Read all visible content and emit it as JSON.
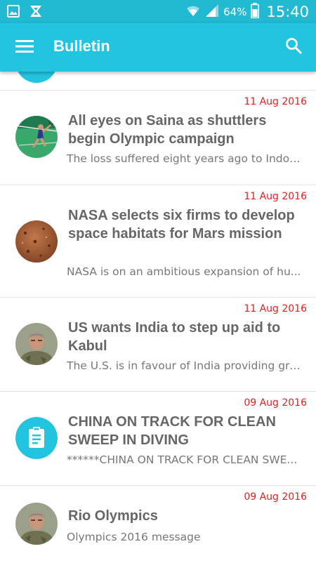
{
  "status_bar": {
    "battery_percent": "64%",
    "time": "15:40",
    "icons": [
      "gallery-notification-icon",
      "x-notification-icon",
      "wifi-icon",
      "signal-icon",
      "battery-icon"
    ]
  },
  "app_bar": {
    "title": "Bulletin",
    "menu_icon": "hamburger-menu-icon",
    "search_icon": "search-icon"
  },
  "colors": {
    "status_bar": "#22b9d2",
    "app_bar": "#22c4df",
    "date": "#e02020",
    "title": "#666666",
    "desc": "#777777",
    "divider": "#e2e2e2"
  },
  "items": [
    {
      "date": "11 Aug 2016",
      "title": "All eyes on Saina as shuttlers begin Olympic campaign",
      "desc": "The loss suffered eight years ago to Indon...",
      "avatar": "badminton-photo"
    },
    {
      "date": "11 Aug 2016",
      "title": "NASA selects six firms to develop space habitats for Mars mission",
      "desc": "NASA is on an ambitious expansion of hu...",
      "avatar": "mars-surface-photo"
    },
    {
      "date": "11 Aug 2016",
      "title": "US wants India to step up aid to Kabul",
      "desc": "The U.S. is in favour of India providing gre...",
      "avatar": "soldier-photo"
    },
    {
      "date": "09 Aug 2016",
      "title": "CHINA ON TRACK FOR CLEAN SWEEP IN DIVING",
      "desc": "******CHINA ON TRACK FOR CLEAN SWE...",
      "avatar": "clipboard-icon"
    },
    {
      "date": "09 Aug 2016",
      "title": "Rio Olympics",
      "desc": "Olympics 2016 message",
      "avatar": "soldier-photo"
    }
  ]
}
